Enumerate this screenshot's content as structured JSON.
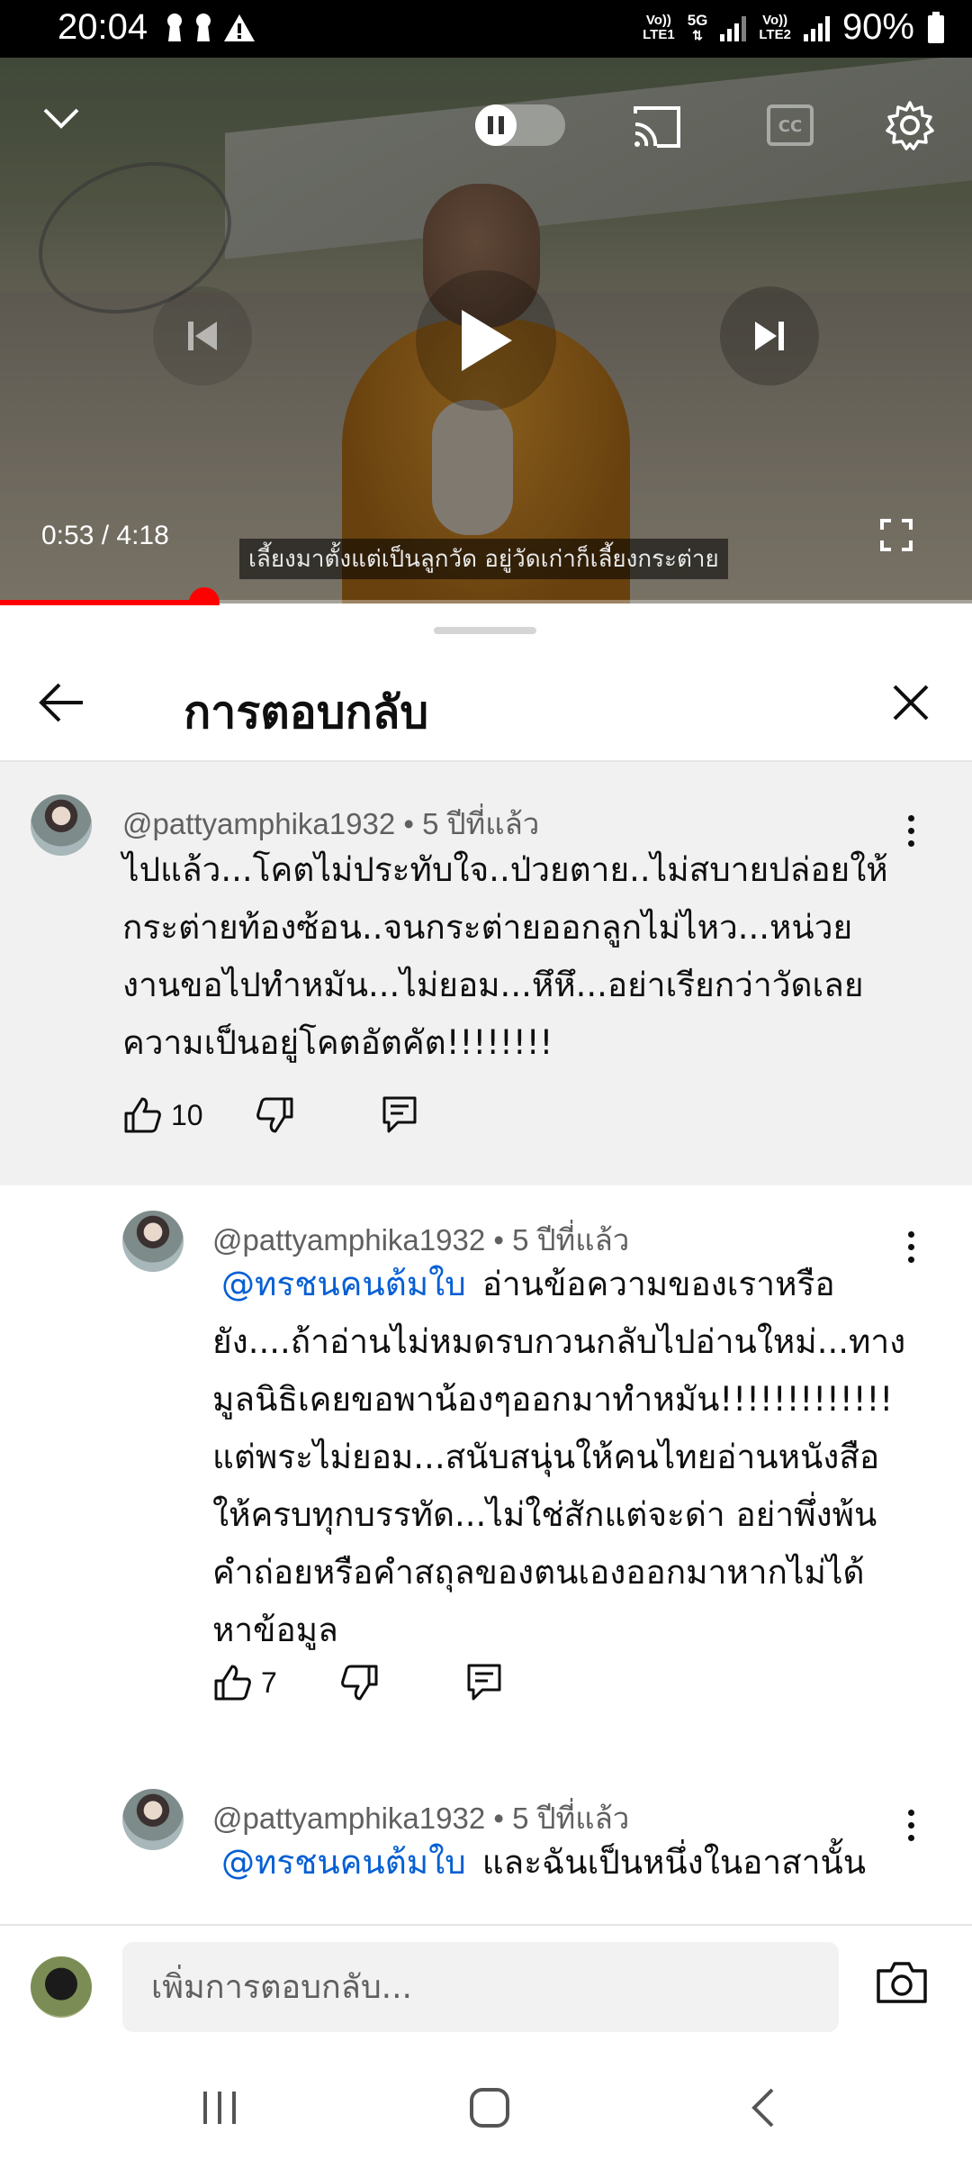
{
  "status_bar": {
    "time": "20:04",
    "net1_top": "Vo))",
    "net1_bottom": "LTE1",
    "net_5g": "5G",
    "net2_top": "Vo))",
    "net2_bottom": "LTE2",
    "battery": "90%"
  },
  "video": {
    "time_current": "0:53",
    "time_total": "4:18",
    "time_display": "0:53 / 4:18",
    "caption": "เลี้ยงมาตั้งแต่เป็นลูกวัด อยู่วัดเก่าก็เลี้ยงกระต่าย",
    "progress_fraction": 0.21
  },
  "sheet": {
    "title": "การตอบกลับ"
  },
  "comments": [
    {
      "author": "@pattyamphika1932",
      "time": "5 ปีที่แล้ว",
      "meta": "@pattyamphika1932 • 5 ปีที่แล้ว",
      "lines": [
        "ไปแล้ว...โคตไม่ประทับใจ..ป่วยตาย..ไม่สบายปล่อยให้",
        "กระต่ายท้องซ้อน..จนกระต่ายออกลูกไม่ไหว...หน่วย",
        "งานขอไปทำหมัน...ไม่ยอม...หึหึ...อย่าเรียกว่าวัดเลย",
        "ความเป็นอยู่โคตอัตคัต!!!!!!!!"
      ],
      "likes": "10"
    },
    {
      "author": "@pattyamphika1932",
      "time": "5 ปีที่แล้ว",
      "meta": "@pattyamphika1932 • 5 ปีที่แล้ว",
      "mention": "@ทรชนคนต้มใบ",
      "first_line": "อ่านข้อความของเราหรือ",
      "lines": [
        "ยัง....ถ้าอ่านไม่หมดรบกวนกลับไปอ่านใหม่...ทาง",
        "มูลนิธิเคยขอพาน้องๆออกมาทำหมัน!!!!!!!!!!!!!",
        "แต่พระไม่ยอม...สนับสนุ่นให้คนไทยอ่านหนังสือ",
        "ให้ครบทุกบรรทัด...ไม่ใช่สักแต่จะด่า อย่าพึ่งพ้น",
        "คำถ่อยหรือคำสถุลของตนเองออกมาหากไม่ได้",
        "หาข้อมูล"
      ],
      "likes": "7"
    },
    {
      "author": "@pattyamphika1932",
      "time": "5 ปีที่แล้ว",
      "meta": "@pattyamphika1932 • 5 ปีที่แล้ว",
      "mention": "@ทรชนคนต้มใบ",
      "first_line": "และฉันเป็นหนึ่งในอาสานั้น"
    }
  ],
  "reply_input": {
    "placeholder": "เพิ่มการตอบกลับ..."
  },
  "colors": {
    "accent_red": "#ff0000",
    "mention_blue": "#065fd4",
    "highlight_bg": "#f1f1f1"
  },
  "icons": [
    "chevron-down-icon",
    "pause-icon",
    "cast-icon",
    "cc-icon",
    "settings-gear-icon",
    "play-icon",
    "previous-icon",
    "next-icon",
    "fullscreen-icon",
    "back-arrow-icon",
    "close-icon",
    "more-vert-icon",
    "thumb-up-icon",
    "thumb-down-icon",
    "reply-icon",
    "camera-icon",
    "recents-nav-icon",
    "home-nav-icon",
    "back-nav-icon"
  ]
}
